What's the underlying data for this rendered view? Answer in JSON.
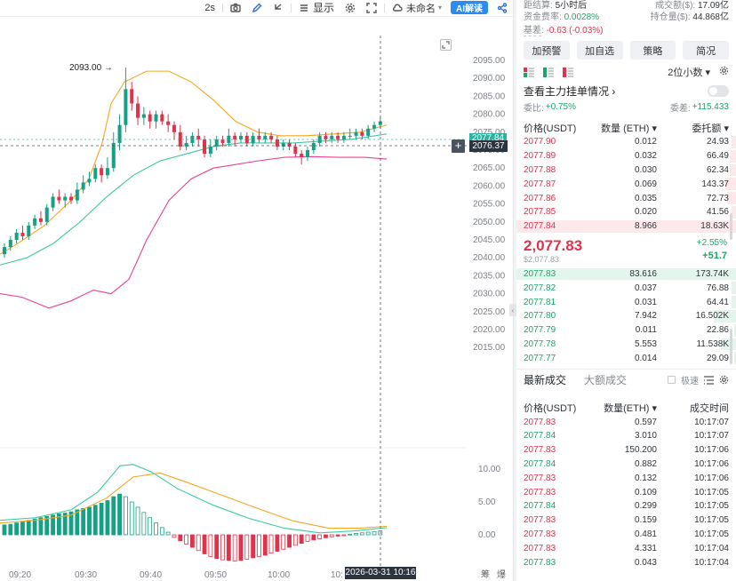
{
  "toolbar": {
    "interval": "2s",
    "display_label": "显示",
    "unnamed_label": "未命名",
    "ai_label": "AI解读"
  },
  "chart": {
    "high_marker": "2093.00 →",
    "price_ticks": [
      "2095.00",
      "2090.00",
      "2085.00",
      "2080.00",
      "2075.00",
      "2070.00",
      "2065.00",
      "2060.00",
      "2055.00",
      "2050.00",
      "2045.00",
      "2040.00",
      "2035.00",
      "2030.00",
      "2025.00",
      "2020.00",
      "2015.00"
    ],
    "macd_ticks": [
      "10.00",
      "5.00",
      "0.00"
    ],
    "time_ticks": [
      "09:20",
      "09:30",
      "09:40",
      "09:50",
      "10:00",
      "10:"
    ],
    "current_price_tag": "2077.84",
    "crosshair_price_tag": "2076.37",
    "crosshair_time_tag": "2026-03-31 10:16",
    "corner_labels": [
      "筹",
      "爆"
    ],
    "colors": {
      "up": "#16a085",
      "down": "#e0324a",
      "ma_fast": "#f5a623",
      "ma_mid": "#3cc9a0",
      "ma_slow": "#e84393"
    }
  },
  "chart_data": {
    "type": "candlestick",
    "x_labels": [
      "09:20",
      "09:30",
      "09:40",
      "09:50",
      "10:00"
    ],
    "ylim": [
      2015,
      2095
    ],
    "high": 2093.0,
    "last": 2077.84,
    "crosshair": 2076.37
  },
  "panel": {
    "top_rows": [
      {
        "label": "距结算",
        "value": "5小时后",
        "label2": "成交额($)",
        "value2": "17.09亿"
      },
      {
        "label": "资金费率",
        "value": "0.0028%",
        "label2": "持仓量($)",
        "value2": "44.868亿"
      },
      {
        "label": "基差",
        "value": "-0.63 (-0.03%)",
        "label2": "",
        "value2": ""
      }
    ],
    "buttons": [
      "加预警",
      "加自选",
      "策略",
      "简况"
    ],
    "decimals": "2位小数 ▾",
    "main_orders": "查看主力挂单情况 ›",
    "wb_left_label": "委比:",
    "wb_left_value": "+0.75%",
    "wb_right_label": "委差:",
    "wb_right_value": "+115.433",
    "ob_headers": [
      "价格(USDT)",
      "数量 (ETH) ▾",
      "委托额 ▾"
    ],
    "asks": [
      {
        "price": "2077.90",
        "qty": "0.012",
        "amt": "24.93",
        "depth": 0.02
      },
      {
        "price": "2077.89",
        "qty": "0.032",
        "amt": "66.49",
        "depth": 0.03
      },
      {
        "price": "2077.88",
        "qty": "0.030",
        "amt": "62.34",
        "depth": 0.03
      },
      {
        "price": "2077.87",
        "qty": "0.069",
        "amt": "143.37",
        "depth": 0.05
      },
      {
        "price": "2077.86",
        "qty": "0.035",
        "amt": "72.73",
        "depth": 0.04
      },
      {
        "price": "2077.85",
        "qty": "0.020",
        "amt": "41.56",
        "depth": 0.02
      },
      {
        "price": "2077.84",
        "qty": "8.966",
        "amt": "18.63K",
        "depth": 1.0
      }
    ],
    "mid": {
      "price": "2,077.83",
      "sub": "$2,077.83",
      "pct": "+2.55%",
      "chg": "+51.7"
    },
    "bids": [
      {
        "price": "2077.83",
        "qty": "83.616",
        "amt": "173.74K",
        "depth": 1.0
      },
      {
        "price": "2077.82",
        "qty": "0.037",
        "amt": "76.88",
        "depth": 0.02
      },
      {
        "price": "2077.81",
        "qty": "0.031",
        "amt": "64.41",
        "depth": 0.02
      },
      {
        "price": "2077.80",
        "qty": "7.942",
        "amt": "16.502K",
        "depth": 0.1
      },
      {
        "price": "2077.79",
        "qty": "0.011",
        "amt": "22.86",
        "depth": 0.01
      },
      {
        "price": "2077.78",
        "qty": "5.553",
        "amt": "11.538K",
        "depth": 0.07
      },
      {
        "price": "2077.77",
        "qty": "0.014",
        "amt": "29.09",
        "depth": 0.01
      }
    ],
    "tabs": [
      "最新成交",
      "大额成交"
    ],
    "filter_label": "极速",
    "tr_headers": [
      "价格(USDT)",
      "数量(ETH) ▾",
      "成交时间"
    ],
    "trades": [
      {
        "price": "2077.83",
        "qty": "0.597",
        "time": "10:17:07",
        "side": "r"
      },
      {
        "price": "2077.84",
        "qty": "3.010",
        "time": "10:17:07",
        "side": "g"
      },
      {
        "price": "2077.83",
        "qty": "150.200",
        "time": "10:17:06",
        "side": "r"
      },
      {
        "price": "2077.84",
        "qty": "0.882",
        "time": "10:17:06",
        "side": "g"
      },
      {
        "price": "2077.83",
        "qty": "0.132",
        "time": "10:17:06",
        "side": "r"
      },
      {
        "price": "2077.83",
        "qty": "0.109",
        "time": "10:17:05",
        "side": "r"
      },
      {
        "price": "2077.84",
        "qty": "0.299",
        "time": "10:17:05",
        "side": "g"
      },
      {
        "price": "2077.83",
        "qty": "0.159",
        "time": "10:17:05",
        "side": "r"
      },
      {
        "price": "2077.83",
        "qty": "0.481",
        "time": "10:17:05",
        "side": "r"
      },
      {
        "price": "2077.83",
        "qty": "4.331",
        "time": "10:17:04",
        "side": "r"
      },
      {
        "price": "2077.83",
        "qty": "0.043",
        "time": "10:17:04",
        "side": "g"
      }
    ]
  }
}
